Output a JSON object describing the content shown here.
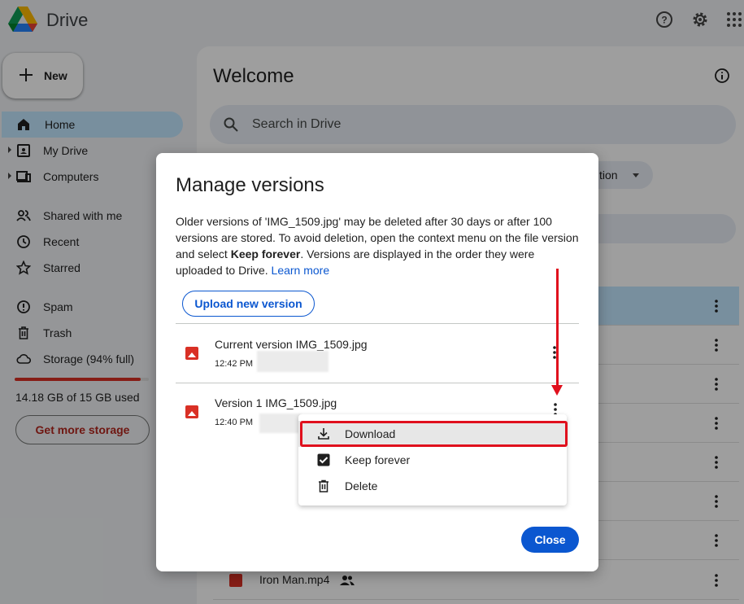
{
  "app": {
    "name": "Drive"
  },
  "topbar": {
    "icons": [
      "help-icon",
      "settings-icon",
      "apps-grid-icon"
    ]
  },
  "sidebar": {
    "new_label": "New",
    "items": [
      {
        "label": "Home",
        "icon": "home-icon",
        "active": true
      },
      {
        "label": "My Drive",
        "icon": "my-drive-icon"
      },
      {
        "label": "Computers",
        "icon": "computers-icon"
      },
      {
        "label": "Shared with me",
        "icon": "shared-icon"
      },
      {
        "label": "Recent",
        "icon": "clock-icon"
      },
      {
        "label": "Starred",
        "icon": "star-icon"
      },
      {
        "label": "Spam",
        "icon": "spam-icon"
      },
      {
        "label": "Trash",
        "icon": "trash-icon"
      },
      {
        "label": "Storage (94% full)",
        "icon": "cloud-icon"
      }
    ],
    "storage_used": "14.18 GB of 15 GB used",
    "storage_fraction": 0.94,
    "get_storage_label": "Get more storage"
  },
  "main": {
    "title": "Welcome",
    "search_placeholder": "Search in Drive",
    "chip_label": "tion",
    "visible_file": "Iron Man.mp4"
  },
  "dialog": {
    "title": "Manage versions",
    "desc_part1": "Older versions of 'IMG_1509.jpg' may be deleted after 30 days or after 100 versions are stored. To avoid deletion, open the context menu on the file version and select ",
    "desc_bold": "Keep forever",
    "desc_part2": ". Versions are displayed in the order they were uploaded to Drive. ",
    "learn_more": "Learn more",
    "upload_label": "Upload new version",
    "versions": [
      {
        "name": "Current version  IMG_1509.jpg",
        "time": "12:42 PM"
      },
      {
        "name": "Version 1  IMG_1509.jpg",
        "time": "12:40 PM"
      }
    ],
    "menu": [
      {
        "label": "Download",
        "icon": "download-icon"
      },
      {
        "label": "Keep forever",
        "icon": "checkbox-icon"
      },
      {
        "label": "Delete",
        "icon": "trash-icon"
      }
    ],
    "close_label": "Close"
  },
  "colors": {
    "accent": "#0b57d0",
    "annotation": "#e0101d",
    "active_nav": "#c2e7ff"
  }
}
